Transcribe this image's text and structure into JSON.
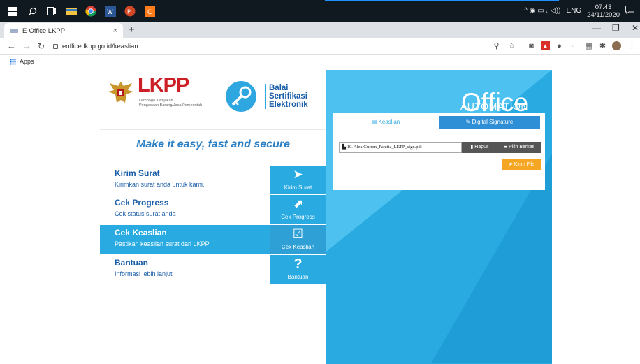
{
  "taskbar": {
    "clock_time": "07.43",
    "clock_date": "24/11/2020",
    "lang": "ENG",
    "tray_glyphs": "^  ◉  ▭  ◟  ◁))"
  },
  "browser": {
    "tab_title": "E-Office LKPP",
    "tab_close": "×",
    "new_tab": "+",
    "url": "eoffice.lkpp.go.id/keaslian",
    "bookmarks_apps": "Apps"
  },
  "header": {
    "lkpp_title": "LKPP",
    "lkpp_sub1": "Lembaga Kebijakan",
    "lkpp_sub2": "Pengadaan Barang/Jasa Pemerintah",
    "bse_line1": "Balai",
    "bse_line2": "Sertifikasi",
    "bse_line3": "Elektronik",
    "tagline": "Make it easy, fast and secure"
  },
  "menu": [
    {
      "title": "Kirim Surat",
      "desc": "Kirimkan surat anda untuk kami.",
      "btn": "Kirim Surat",
      "icon": "paper-plane-icon",
      "glyph": "➤"
    },
    {
      "title": "Cek Progress",
      "desc": "Cek status surat anda",
      "btn": "Cek Progress",
      "icon": "chart-icon",
      "glyph": "⬈"
    },
    {
      "title": "Cek Keaslian",
      "desc": "Pastikan keaslian surat dari LKPP",
      "btn": "Cek Keaslian",
      "icon": "checkbox-icon",
      "glyph": "☑"
    },
    {
      "title": "Bantuan",
      "desc": "Informasi lebih lanjut",
      "btn": "Bantuan",
      "icon": "question-icon",
      "glyph": "?"
    }
  ],
  "office": {
    "title": "Office",
    "subtitle": "AUTOMATION",
    "tab_keaslian": "Keaslian",
    "tab_digital_signature": "Digital Signature",
    "file_name": "10. Alex Gufron_Panitia_LKPP_sign.pdf",
    "btn_hapus": "Hapus",
    "btn_pilih": "Pilih Berkas",
    "btn_kirim": "Kirim File"
  },
  "colors": {
    "brand_blue": "#29abe2",
    "dark_blue": "#1a5ea8",
    "lkpp_red": "#cc1f26",
    "orange": "#f5a623"
  }
}
